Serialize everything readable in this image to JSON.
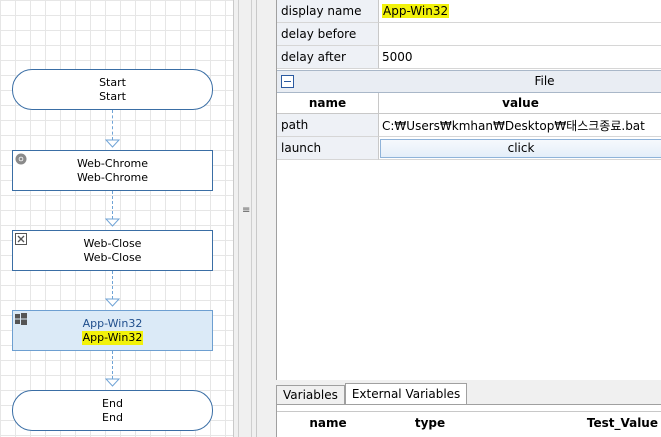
{
  "flow": {
    "nodes": [
      {
        "line1": "Start",
        "line2": "Start"
      },
      {
        "line1": "Web-Chrome",
        "line2": "Web-Chrome",
        "icon": "chrome-icon"
      },
      {
        "line1": "Web-Close",
        "line2": "Web-Close",
        "icon": "close-box-icon"
      },
      {
        "line1": "App-Win32",
        "line2": "App-Win32",
        "icon": "windows-icon"
      },
      {
        "line1": "End",
        "line2": "End"
      }
    ]
  },
  "props": {
    "rows": [
      {
        "name": "display name",
        "value": "App-Win32"
      },
      {
        "name": "delay before",
        "value": ""
      },
      {
        "name": "delay after",
        "value": "5000"
      }
    ],
    "category": "File",
    "header": {
      "name": "name",
      "value": "value"
    },
    "path": {
      "name": "path",
      "value": "C:₩Users₩kmhan₩Desktop₩태스크종료.bat"
    },
    "launch": {
      "name": "launch",
      "button": "click"
    }
  },
  "tabs": [
    "Variables",
    "External Variables"
  ],
  "vars_columns": [
    "name",
    "type",
    "Test_Value"
  ],
  "colors": {
    "highlight": "#f2f20a",
    "selected_node": "#dbeaf7",
    "accent": "#3a6ea5"
  }
}
